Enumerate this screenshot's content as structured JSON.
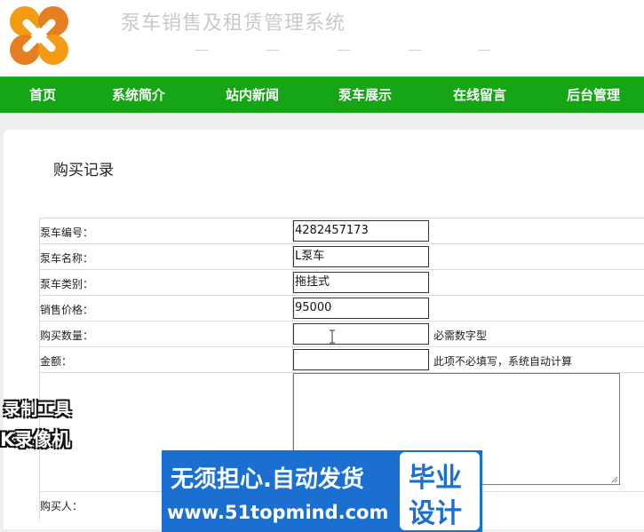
{
  "header": {
    "site_title": "泵车销售及租赁管理系统",
    "logo_colors": [
      "#f39c12",
      "#e67e22"
    ]
  },
  "nav": {
    "items": [
      {
        "label": "首页"
      },
      {
        "label": "系统简介"
      },
      {
        "label": "站内新闻"
      },
      {
        "label": "泵车展示"
      },
      {
        "label": "在线留言"
      },
      {
        "label": "后台管理"
      }
    ],
    "bg_color": "#15a515"
  },
  "page": {
    "section_title": "购买记录"
  },
  "form": {
    "fields": [
      {
        "label": "泵车编号：",
        "value": "4282457173",
        "hint": ""
      },
      {
        "label": "泵车名称：",
        "value": "L泵车",
        "hint": ""
      },
      {
        "label": "泵车类别：",
        "value": "拖挂式",
        "hint": ""
      },
      {
        "label": "销售价格：",
        "value": "95000",
        "hint": ""
      },
      {
        "label": "购买数量：",
        "value": "",
        "hint": "必需数字型"
      },
      {
        "label": "金额：",
        "value": "",
        "hint": "此项不必填写，系统自动计算"
      }
    ],
    "buyer_label": "购买人："
  },
  "watermark": {
    "left_line1": "录制工具",
    "left_line2": "K录像机",
    "banner_text": "无须担心.自动发货",
    "banner_url": "www.51topmind.com",
    "badge_line1": "毕业",
    "badge_line2": "设计"
  }
}
